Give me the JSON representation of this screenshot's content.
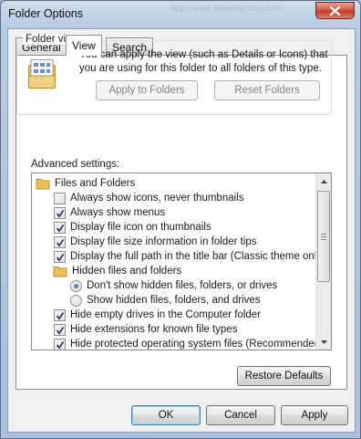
{
  "window": {
    "title": "Folder Options",
    "watermark": "http://www.sevenforums.com"
  },
  "tabs": [
    {
      "label": "General",
      "active": false
    },
    {
      "label": "View",
      "active": true
    },
    {
      "label": "Search",
      "active": false
    }
  ],
  "folder_views": {
    "label": "Folder views",
    "description": "You can apply the view (such as Details or Icons) that you are using for this folder to all folders of this type.",
    "apply_button": "Apply to Folders",
    "reset_button": "Reset Folders"
  },
  "advanced": {
    "label": "Advanced settings:",
    "items": [
      {
        "type": "folder",
        "label": "Files and Folders",
        "indent": 0
      },
      {
        "type": "checkbox",
        "label": "Always show icons, never thumbnails",
        "checked": false,
        "indent": 1
      },
      {
        "type": "checkbox",
        "label": "Always show menus",
        "checked": true,
        "indent": 1
      },
      {
        "type": "checkbox",
        "label": "Display file icon on thumbnails",
        "checked": true,
        "indent": 1
      },
      {
        "type": "checkbox",
        "label": "Display file size information in folder tips",
        "checked": true,
        "indent": 1
      },
      {
        "type": "checkbox",
        "label": "Display the full path in the title bar (Classic theme only)",
        "checked": true,
        "indent": 1
      },
      {
        "type": "folder",
        "label": "Hidden files and folders",
        "indent": 1
      },
      {
        "type": "radio",
        "label": "Don't show hidden files, folders, or drives",
        "checked": true,
        "indent": 2
      },
      {
        "type": "radio",
        "label": "Show hidden files, folders, and drives",
        "checked": false,
        "indent": 2
      },
      {
        "type": "checkbox",
        "label": "Hide empty drives in the Computer folder",
        "checked": true,
        "indent": 1
      },
      {
        "type": "checkbox",
        "label": "Hide extensions for known file types",
        "checked": true,
        "indent": 1
      },
      {
        "type": "checkbox",
        "label": "Hide protected operating system files (Recommended)",
        "checked": true,
        "indent": 1
      }
    ]
  },
  "restore_defaults": "Restore Defaults",
  "buttons": {
    "ok": "OK",
    "cancel": "Cancel",
    "apply": "Apply"
  },
  "colors": {
    "accent": "#1f4f9a",
    "checkmark": "#2d3d7a",
    "folder": "#e8c257"
  }
}
